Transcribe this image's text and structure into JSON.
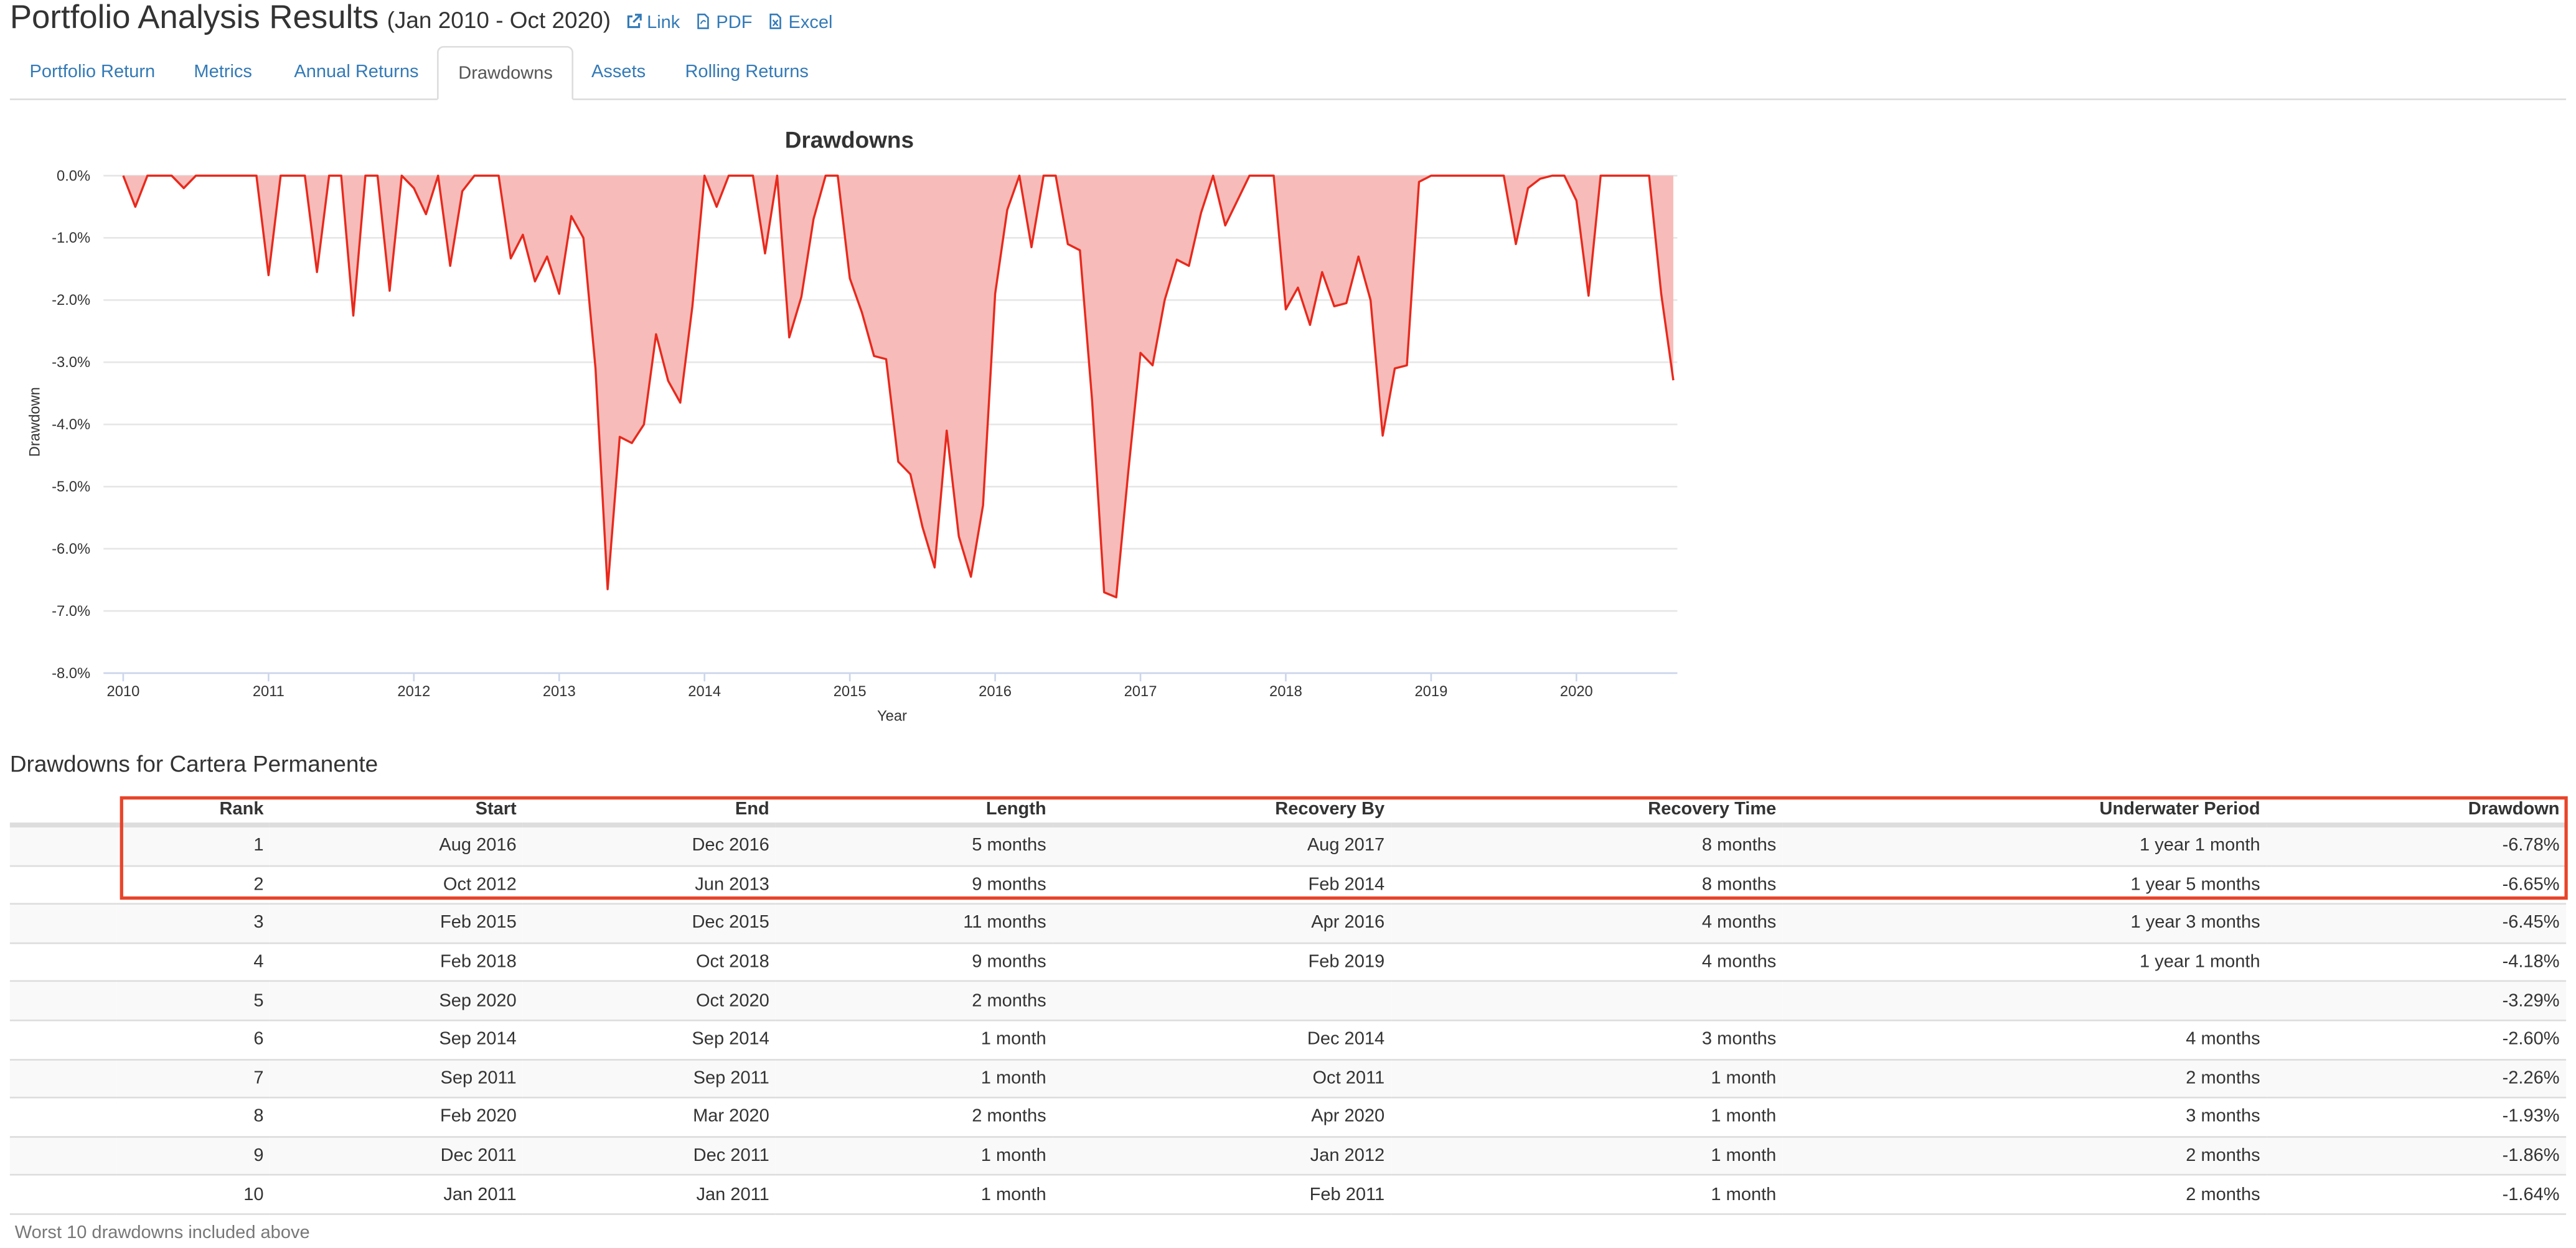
{
  "header": {
    "title": "Portfolio Analysis Results",
    "range": "(Jan 2010 - Oct 2020)",
    "links": [
      {
        "label": "Link",
        "icon": "external-link-icon"
      },
      {
        "label": "PDF",
        "icon": "pdf-file-icon"
      },
      {
        "label": "Excel",
        "icon": "excel-file-icon"
      }
    ]
  },
  "tabs": [
    {
      "label": "Portfolio Return",
      "active": false
    },
    {
      "label": "Metrics",
      "active": false
    },
    {
      "label": "Annual Returns",
      "active": false
    },
    {
      "label": "Drawdowns",
      "active": true
    },
    {
      "label": "Assets",
      "active": false
    },
    {
      "label": "Rolling Returns",
      "active": false
    }
  ],
  "chart_data": {
    "type": "area",
    "title": "Drawdowns",
    "xlabel": "Year",
    "ylabel": "Drawdown",
    "xlim": [
      2010,
      2020.83
    ],
    "ylim": [
      -8.0,
      0.0
    ],
    "x_ticks": [
      "2010",
      "2011",
      "2012",
      "2013",
      "2014",
      "2015",
      "2016",
      "2017",
      "2018",
      "2019",
      "2020"
    ],
    "y_ticks": [
      "0.0%",
      "-1.0%",
      "-2.0%",
      "-3.0%",
      "-4.0%",
      "-5.0%",
      "-6.0%",
      "-7.0%",
      "-8.0%"
    ],
    "grid": true,
    "line_color": "#e8291c",
    "fill_color": "#f7bcba",
    "series": [
      {
        "x_start": "Jan 2010",
        "x_step": "1 month",
        "values": [
          0,
          -0.5,
          0,
          0,
          0,
          -0.2,
          0,
          0,
          0,
          0,
          0,
          0,
          -1.6,
          0,
          0,
          0,
          -1.55,
          0,
          0,
          -2.25,
          0,
          0,
          -1.85,
          0,
          -0.2,
          -0.62,
          0,
          -1.45,
          -0.25,
          0,
          0,
          0,
          -1.33,
          -0.95,
          -1.7,
          -1.3,
          -1.9,
          -0.65,
          -1.0,
          -3.1,
          -6.65,
          -4.2,
          -4.3,
          -4.0,
          -2.55,
          -3.3,
          -3.65,
          -2.1,
          0,
          -0.5,
          0,
          0,
          0,
          -1.25,
          0,
          -2.6,
          -1.95,
          -0.7,
          0,
          0,
          -1.65,
          -2.2,
          -2.9,
          -2.95,
          -4.6,
          -4.8,
          -5.65,
          -6.3,
          -4.1,
          -5.8,
          -6.45,
          -5.3,
          -1.9,
          -0.55,
          0,
          -1.15,
          0,
          0,
          -1.1,
          -1.2,
          -3.6,
          -6.7,
          -6.78,
          -4.75,
          -2.85,
          -3.05,
          -2.0,
          -1.35,
          -1.45,
          -0.6,
          0,
          -0.8,
          -0.4,
          0,
          0,
          0,
          -2.15,
          -1.8,
          -2.4,
          -1.55,
          -2.1,
          -2.05,
          -1.3,
          -2.0,
          -4.18,
          -3.1,
          -3.05,
          -0.1,
          0,
          0,
          0,
          0,
          0,
          0,
          0,
          -1.1,
          -0.2,
          -0.05,
          0,
          0,
          -0.4,
          -1.93,
          0,
          0,
          0,
          0,
          0,
          -1.9,
          -3.29
        ]
      }
    ]
  },
  "table": {
    "section_title": "Drawdowns for Cartera Permanente",
    "columns": [
      "Rank",
      "Start",
      "End",
      "Length",
      "Recovery By",
      "Recovery Time",
      "Underwater Period",
      "Drawdown"
    ],
    "rows": [
      [
        "1",
        "Aug 2016",
        "Dec 2016",
        "5 months",
        "Aug 2017",
        "8 months",
        "1 year 1 month",
        "-6.78%"
      ],
      [
        "2",
        "Oct 2012",
        "Jun 2013",
        "9 months",
        "Feb 2014",
        "8 months",
        "1 year 5 months",
        "-6.65%"
      ],
      [
        "3",
        "Feb 2015",
        "Dec 2015",
        "11 months",
        "Apr 2016",
        "4 months",
        "1 year 3 months",
        "-6.45%"
      ],
      [
        "4",
        "Feb 2018",
        "Oct 2018",
        "9 months",
        "Feb 2019",
        "4 months",
        "1 year 1 month",
        "-4.18%"
      ],
      [
        "5",
        "Sep 2020",
        "Oct 2020",
        "2 months",
        "",
        "",
        "",
        "-3.29%"
      ],
      [
        "6",
        "Sep 2014",
        "Sep 2014",
        "1 month",
        "Dec 2014",
        "3 months",
        "4 months",
        "-2.60%"
      ],
      [
        "7",
        "Sep 2011",
        "Sep 2011",
        "1 month",
        "Oct 2011",
        "1 month",
        "2 months",
        "-2.26%"
      ],
      [
        "8",
        "Feb 2020",
        "Mar 2020",
        "2 months",
        "Apr 2020",
        "1 month",
        "3 months",
        "-1.93%"
      ],
      [
        "9",
        "Dec 2011",
        "Dec 2011",
        "1 month",
        "Jan 2012",
        "1 month",
        "2 months",
        "-1.86%"
      ],
      [
        "10",
        "Jan 2011",
        "Jan 2011",
        "1 month",
        "Feb 2011",
        "1 month",
        "2 months",
        "-1.64%"
      ]
    ],
    "highlight_color": "#e8442a",
    "footnote": "Worst 10 drawdowns included above"
  }
}
